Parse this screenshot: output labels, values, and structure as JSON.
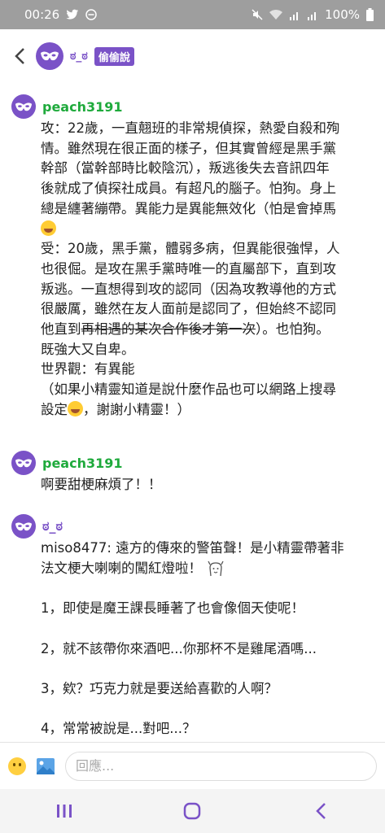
{
  "status_bar": {
    "time": "00:26",
    "battery": "100%"
  },
  "header": {
    "name": "ಠ_ಠ",
    "badge": "偷偷說"
  },
  "messages": [
    {
      "username": "peach3191",
      "username_color": "#1faa3c",
      "lines": [
        "攻：22歲，一直翹班的非常規偵探，熱愛自殺和殉",
        "情。雖然現在很正面的樣子，但其實曾經是黑手黨",
        "幹部（當幹部時比較陰沉），叛逃後失去音訊四年",
        "後就成了偵探社成員。有超凡的腦子。怕狗。身上",
        "總是纏著繃帶。異能力是異能無效化（怕是會掉馬",
        "受：20歲，黑手黨，體弱多病，但異能很強悍，人",
        "也很倔。是攻在黑手黨時唯一的直屬部下，直到攻",
        "叛逃。一直想得到攻的認同（因為攻教導他的方式",
        "很嚴厲，雖然在友人面前是認同了，但始終不認同",
        "他直到",
        "再相遇的某次合作後才第一次",
        "）。也怕狗。",
        "既強大又自卑。",
        "世界觀：有異能",
        "（如果小精靈知道是說什麼作品也可以網路上搜尋",
        "設定",
        "，謝謝小精靈！）"
      ]
    },
    {
      "username": "peach3191",
      "username_color": "#1faa3c",
      "text": "啊要甜梗麻煩了！！"
    },
    {
      "username": "ಠ_ಠ",
      "username_color": "#7a52c7",
      "lines": [
        "miso8477: 遠方的傳來的警笛聲！是小精靈帶著非",
        "法文梗大喇喇的闖紅燈啦！",
        "1，即使是魔王課長睡著了也會像個天使呢！",
        "2，就不該帶你來酒吧...你那杯不是雞尾酒嗎...",
        "3，欸？巧克力就是要送給喜歡的人啊？",
        "4，常常被說是...對吧...？"
      ]
    }
  ],
  "input": {
    "placeholder": "回應..."
  },
  "icons": {
    "back": "back-arrow-icon",
    "avatar": "mask-icon",
    "emoji": "grinning-sweat-emoji-icon",
    "sticker": "gif-sticker-icon",
    "smile": "smile-icon",
    "image": "image-icon"
  },
  "colors": {
    "accent_purple": "#7a52c7",
    "username_green": "#1faa3c"
  }
}
